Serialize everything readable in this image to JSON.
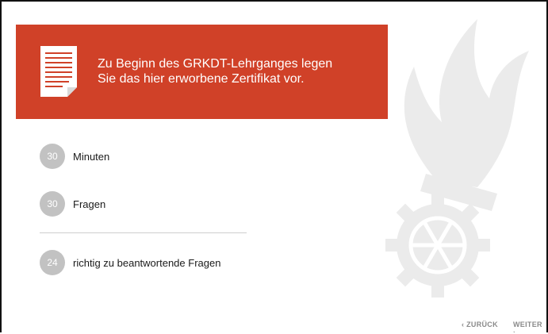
{
  "banner": {
    "line1": "Zu Beginn des GRKDT-Lehrganges legen",
    "line2": "Sie das hier erworbene Zertifikat vor.",
    "color": "#d04128"
  },
  "stats": [
    {
      "value": "30",
      "label": "Minuten"
    },
    {
      "value": "30",
      "label": "Fragen"
    },
    {
      "value": "24",
      "label": "richtig zu beantwortende Fragen"
    }
  ],
  "nav": {
    "back_label": "‹ ZURÜCK",
    "next_label": "WEITER ›"
  },
  "icons": {
    "document": "document-icon",
    "emblem": "fire-brigade-emblem-icon"
  }
}
